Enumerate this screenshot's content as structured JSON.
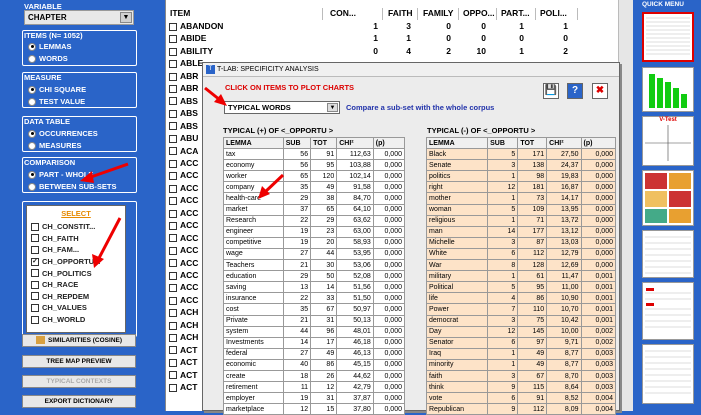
{
  "sidebar": {
    "variable": {
      "label": "VARIABLE",
      "value": "CHAPTER"
    },
    "items": {
      "label": "ITEMS (N= 1052)",
      "options": [
        "LEMMAS",
        "WORDS"
      ],
      "selected": 0
    },
    "measure": {
      "label": "MEASURE",
      "options": [
        "CHI SQUARE",
        "TEST VALUE"
      ],
      "selected": 0
    },
    "datatable": {
      "label": "DATA TABLE",
      "options": [
        "OCCURRENCES",
        "MEASURES"
      ],
      "selected": 0
    },
    "comparison": {
      "label": "COMPARISON",
      "options": [
        "PART - WHOLE",
        "BETWEEN SUB-SETS"
      ],
      "selected": 0
    },
    "select": {
      "header": "SELECT",
      "items": [
        {
          "label": "CH_CONSTIT...",
          "checked": false
        },
        {
          "label": "CH_FAITH",
          "checked": false
        },
        {
          "label": "CH_FAM...",
          "checked": false
        },
        {
          "label": "CH_OPPORTU...",
          "checked": true
        },
        {
          "label": "CH_POLITICS",
          "checked": false
        },
        {
          "label": "CH_RACE",
          "checked": false
        },
        {
          "label": "CH_REPDEM",
          "checked": false
        },
        {
          "label": "CH_VALUES",
          "checked": false
        },
        {
          "label": "CH_WORLD",
          "checked": false
        }
      ]
    },
    "buttons": [
      "SIMILARITIES (COSINE)",
      "TREE MAP PREVIEW",
      "TYPICAL CONTEXTS",
      "EXPORT DICTIONARY"
    ]
  },
  "main": {
    "headers": [
      "ITEM",
      "CON...",
      "FAITH",
      "FAMILY",
      "OPPO...",
      "PART...",
      "POLI..."
    ],
    "rows": [
      {
        "item": "ABANDON",
        "v": [
          "1",
          "3",
          "0",
          "0",
          "1",
          "1"
        ]
      },
      {
        "item": "ABIDE",
        "v": [
          "1",
          "1",
          "0",
          "0",
          "0",
          "0"
        ]
      },
      {
        "item": "ABILITY",
        "v": [
          "0",
          "4",
          "2",
          "10",
          "1",
          "2"
        ]
      },
      {
        "item": "ABLE",
        "v": []
      },
      {
        "item": "ABR",
        "v": []
      },
      {
        "item": "ABR",
        "v": []
      },
      {
        "item": "ABS",
        "v": []
      },
      {
        "item": "ABS",
        "v": []
      },
      {
        "item": "ABS",
        "v": []
      },
      {
        "item": "ABU",
        "v": []
      },
      {
        "item": "ACA",
        "v": []
      },
      {
        "item": "ACC",
        "v": []
      },
      {
        "item": "ACC",
        "v": []
      },
      {
        "item": "ACC",
        "v": []
      },
      {
        "item": "ACC",
        "v": []
      },
      {
        "item": "ACC",
        "v": []
      },
      {
        "item": "ACC",
        "v": []
      },
      {
        "item": "ACC",
        "v": []
      },
      {
        "item": "ACC",
        "v": []
      },
      {
        "item": "ACC",
        "v": []
      },
      {
        "item": "ACC",
        "v": []
      },
      {
        "item": "ACC",
        "v": []
      },
      {
        "item": "ACC",
        "v": []
      },
      {
        "item": "ACH",
        "v": []
      },
      {
        "item": "ACH",
        "v": []
      },
      {
        "item": "ACH",
        "v": []
      },
      {
        "item": "ACT",
        "v": []
      },
      {
        "item": "ACT",
        "v": []
      },
      {
        "item": "ACT",
        "v": []
      },
      {
        "item": "ACT",
        "v": []
      }
    ]
  },
  "quick_menu": {
    "title": "QUICK MENU",
    "vtest_label": "V-Test"
  },
  "dialog": {
    "title": "T-LAB: SPECIFICITY ANALYSIS",
    "click_hint": "CLICK ON ITEMS TO PLOT CHARTS",
    "dropdown_value": "TYPICAL WORDS",
    "compare_text": "Compare a sub-set with the whole corpus",
    "positive_title": "TYPICAL (+) OF <_OPPORTU >",
    "negative_title": "TYPICAL (-) OF <_OPPORTU >",
    "columns": [
      "LEMMA",
      "SUB",
      "TOT",
      "CHI²",
      "(p)"
    ],
    "positive": [
      [
        "tax",
        "56",
        "91",
        "112,63",
        "0,000"
      ],
      [
        "economy",
        "56",
        "95",
        "103,88",
        "0,000"
      ],
      [
        "worker",
        "65",
        "120",
        "102,14",
        "0,000"
      ],
      [
        "company",
        "35",
        "49",
        "91,58",
        "0,000"
      ],
      [
        "health-care",
        "29",
        "38",
        "84,70",
        "0,000"
      ],
      [
        "market",
        "37",
        "65",
        "64,10",
        "0,000"
      ],
      [
        "Research",
        "22",
        "29",
        "63,62",
        "0,000"
      ],
      [
        "engineer",
        "19",
        "23",
        "63,00",
        "0,000"
      ],
      [
        "competitive",
        "19",
        "20",
        "58,93",
        "0,000"
      ],
      [
        "wage",
        "27",
        "44",
        "53,95",
        "0,000"
      ],
      [
        "Teachers",
        "21",
        "30",
        "53,06",
        "0,000"
      ],
      [
        "education",
        "29",
        "50",
        "52,08",
        "0,000"
      ],
      [
        "saving",
        "13",
        "14",
        "51,56",
        "0,000"
      ],
      [
        "insurance",
        "22",
        "33",
        "51,50",
        "0,000"
      ],
      [
        "cost",
        "35",
        "67",
        "50,97",
        "0,000"
      ],
      [
        "Private",
        "21",
        "31",
        "50,13",
        "0,000"
      ],
      [
        "system",
        "44",
        "96",
        "48,01",
        "0,000"
      ],
      [
        "Investments",
        "14",
        "17",
        "46,18",
        "0,000"
      ],
      [
        "federal",
        "27",
        "49",
        "46,13",
        "0,000"
      ],
      [
        "economic",
        "40",
        "86",
        "45,15",
        "0,000"
      ],
      [
        "create",
        "18",
        "26",
        "44,62",
        "0,000"
      ],
      [
        "retirement",
        "11",
        "12",
        "42,79",
        "0,000"
      ],
      [
        "employer",
        "19",
        "31",
        "37,87",
        "0,000"
      ],
      [
        "marketplace",
        "12",
        "15",
        "37,80",
        "0,000"
      ]
    ],
    "negative": [
      [
        "Black",
        "5",
        "171",
        "27,50",
        "0,000"
      ],
      [
        "Senate",
        "3",
        "138",
        "24,37",
        "0,000"
      ],
      [
        "politics",
        "1",
        "98",
        "19,83",
        "0,000"
      ],
      [
        "right",
        "12",
        "181",
        "16,87",
        "0,000"
      ],
      [
        "mother",
        "1",
        "73",
        "14,17",
        "0,000"
      ],
      [
        "woman",
        "5",
        "109",
        "13,95",
        "0,000"
      ],
      [
        "religious",
        "1",
        "71",
        "13,72",
        "0,000"
      ],
      [
        "man",
        "14",
        "177",
        "13,12",
        "0,000"
      ],
      [
        "Michelle",
        "3",
        "87",
        "13,03",
        "0,000"
      ],
      [
        "White",
        "6",
        "112",
        "12,79",
        "0,000"
      ],
      [
        "War",
        "8",
        "128",
        "12,69",
        "0,000"
      ],
      [
        "military",
        "1",
        "61",
        "11,47",
        "0,001"
      ],
      [
        "Political",
        "5",
        "95",
        "11,00",
        "0,001"
      ],
      [
        "life",
        "4",
        "86",
        "10,90",
        "0,001"
      ],
      [
        "Power",
        "7",
        "110",
        "10,70",
        "0,001"
      ],
      [
        "democrat",
        "3",
        "75",
        "10,42",
        "0,001"
      ],
      [
        "Day",
        "12",
        "145",
        "10,00",
        "0,002"
      ],
      [
        "Senator",
        "6",
        "97",
        "9,71",
        "0,002"
      ],
      [
        "Iraq",
        "1",
        "49",
        "8,77",
        "0,003"
      ],
      [
        "minority",
        "1",
        "49",
        "8,77",
        "0,003"
      ],
      [
        "faith",
        "3",
        "67",
        "8,70",
        "0,003"
      ],
      [
        "think",
        "9",
        "115",
        "8,64",
        "0,003"
      ],
      [
        "vote",
        "6",
        "91",
        "8,52",
        "0,004"
      ],
      [
        "Republican",
        "9",
        "112",
        "8,09",
        "0,004"
      ]
    ]
  }
}
